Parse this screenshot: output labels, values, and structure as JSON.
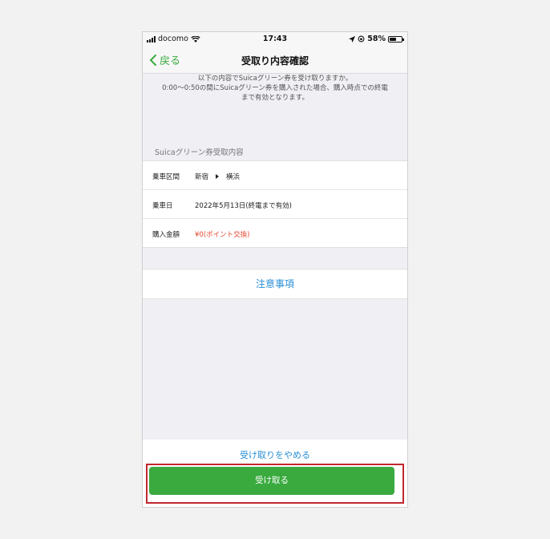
{
  "status_bar": {
    "carrier": "docomo",
    "time": "17:43",
    "battery": "58%",
    "battery_level": 0.58
  },
  "nav": {
    "back_label": "戻る",
    "title": "受取り内容確認"
  },
  "intro": {
    "lines": [
      "以下の内容でSuicaグリーン券を受け取りますか。",
      "0:00〜0:50の間にSuicaグリーン券を購入された場合、購入時点での終電",
      "まで有効となります。"
    ]
  },
  "section_header": "Suicaグリーン券受取内容",
  "details": {
    "route_label": "乗車区間",
    "route_from": "新宿",
    "route_to": "横浜",
    "date_label": "乗車日",
    "date_value": "2022年5月13日(終電まで有効)",
    "price_label": "購入金額",
    "price_value": "¥0(ポイント交換)"
  },
  "notes_label": "注意事項",
  "cancel_label": "受け取りをやめる",
  "accept_label": "受け取る",
  "colors": {
    "accent_green": "#3aaa3f",
    "link_blue": "#2a8fd6",
    "price_red": "#e5452f",
    "highlight_red": "#c1272d"
  }
}
